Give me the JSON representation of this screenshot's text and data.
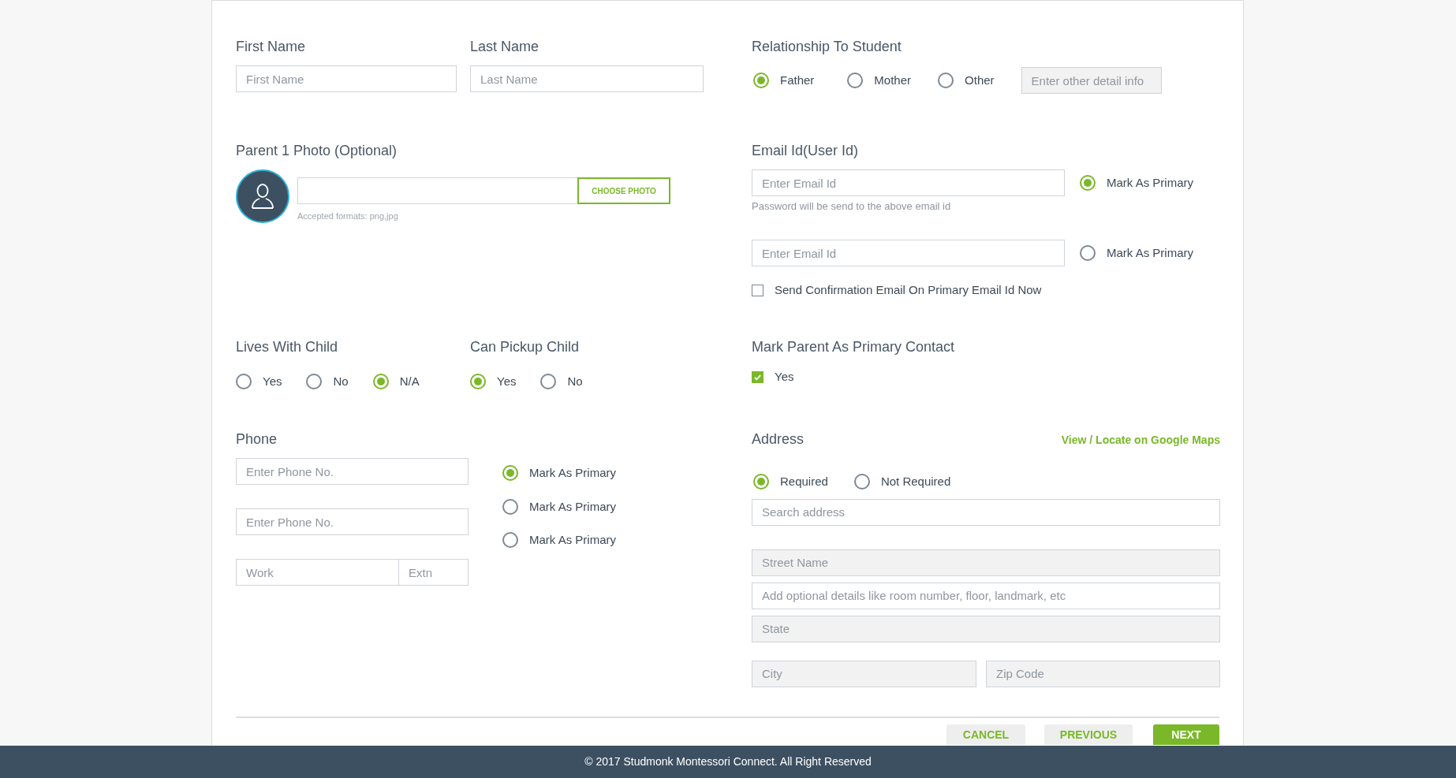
{
  "name_fields": [
    {
      "label": "First Name",
      "placeholder": "First Name"
    },
    {
      "label": "Last Name",
      "placeholder": "Last Name"
    }
  ],
  "relationship": {
    "label": "Relationship To Student",
    "options": [
      {
        "label": "Father",
        "selected": true
      },
      {
        "label": "Mother",
        "selected": false
      },
      {
        "label": "Other",
        "selected": false
      }
    ],
    "other_placeholder": "Enter other detail info"
  },
  "photo": {
    "label": "Parent 1 Photo (Optional)",
    "button": "CHOOSE PHOTO",
    "hint": "Accepted formats: png,jpg"
  },
  "email": {
    "label": "Email Id(User Id)",
    "entries": [
      {
        "placeholder": "Enter Email Id",
        "primary_label": "Mark As Primary",
        "selected": true,
        "note": "Password will be send to the above email id"
      },
      {
        "placeholder": "Enter Email Id",
        "primary_label": "Mark As Primary",
        "selected": false
      }
    ],
    "confirm": {
      "label": "Send Confirmation Email On Primary Email Id Now",
      "checked": false
    }
  },
  "lives_with_child": {
    "label": "Lives With Child",
    "options": [
      {
        "label": "Yes",
        "selected": false
      },
      {
        "label": "No",
        "selected": false
      },
      {
        "label": "N/A",
        "selected": true
      }
    ]
  },
  "can_pickup_child": {
    "label": "Can Pickup Child",
    "options": [
      {
        "label": "Yes",
        "selected": true
      },
      {
        "label": "No",
        "selected": false
      }
    ]
  },
  "primary_contact": {
    "label": "Mark Parent As Primary Contact",
    "option": {
      "label": "Yes",
      "checked": true
    }
  },
  "phone": {
    "label": "Phone",
    "fields": [
      {
        "kind": "single",
        "placeholder": "Enter Phone No."
      },
      {
        "kind": "single",
        "placeholder": "Enter Phone No."
      },
      {
        "kind": "split",
        "placeholder": "Work",
        "extension_placeholder": "Extn"
      }
    ],
    "primary_options": [
      {
        "label": "Mark As Primary",
        "selected": true
      },
      {
        "label": "Mark As Primary",
        "selected": false
      },
      {
        "label": "Mark As Primary",
        "selected": false
      }
    ]
  },
  "address": {
    "label": "Address",
    "map_link": "View / Locate on Google Maps",
    "options": [
      {
        "label": "Required",
        "selected": true
      },
      {
        "label": "Not Required",
        "selected": false
      }
    ],
    "fields": [
      {
        "kind": "single",
        "placeholder": "Search address",
        "disabled": false
      },
      {
        "kind": "single",
        "placeholder": "Street Name",
        "disabled": true
      },
      {
        "kind": "single",
        "placeholder": "Add optional details like room number, floor, landmark, etc",
        "disabled": false
      },
      {
        "kind": "single",
        "placeholder": "State",
        "disabled": true
      },
      {
        "kind": "pair",
        "items": [
          {
            "placeholder": "City",
            "disabled": true
          },
          {
            "placeholder": "Zip Code",
            "disabled": true
          }
        ]
      }
    ]
  },
  "buttons": [
    {
      "label": "CANCEL",
      "kind": "secondary"
    },
    {
      "label": "PREVIOUS",
      "kind": "secondary"
    },
    {
      "label": "NEXT",
      "kind": "primary"
    }
  ],
  "footer": "© 2017 Studmonk Montessori Connect. All Right Reserved"
}
